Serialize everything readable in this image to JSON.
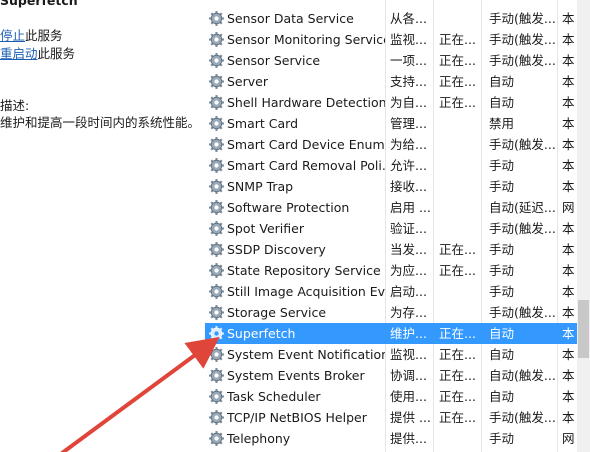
{
  "left_pane": {
    "service_title": "Superfetch",
    "stop_link": "停止",
    "stop_suffix": "此服务",
    "restart_link": "重启动",
    "restart_suffix": "此服务",
    "description_label": "描述:",
    "description_text": "维护和提高一段时间内的系统性能。"
  },
  "rows": [
    {
      "name": "Sensor Data Service",
      "desc": "从各...",
      "status": "",
      "startup": "手动(触发...",
      "logon": "本"
    },
    {
      "name": "Sensor Monitoring Service",
      "desc": "监视...",
      "status": "正在...",
      "startup": "手动(触发...",
      "logon": "本"
    },
    {
      "name": "Sensor Service",
      "desc": "一项...",
      "status": "正在...",
      "startup": "手动(触发...",
      "logon": "本"
    },
    {
      "name": "Server",
      "desc": "支持...",
      "status": "正在...",
      "startup": "自动",
      "logon": "本"
    },
    {
      "name": "Shell Hardware Detection",
      "desc": "为自...",
      "status": "正在...",
      "startup": "自动",
      "logon": "本"
    },
    {
      "name": "Smart Card",
      "desc": "管理...",
      "status": "",
      "startup": "禁用",
      "logon": "本"
    },
    {
      "name": "Smart Card Device Enum...",
      "desc": "为给...",
      "status": "",
      "startup": "手动(触发...",
      "logon": "本"
    },
    {
      "name": "Smart Card Removal Poli...",
      "desc": "允许...",
      "status": "",
      "startup": "手动",
      "logon": "本"
    },
    {
      "name": "SNMP Trap",
      "desc": "接收...",
      "status": "",
      "startup": "手动",
      "logon": "本"
    },
    {
      "name": "Software Protection",
      "desc": "启用 ...",
      "status": "",
      "startup": "自动(延迟...",
      "logon": "网"
    },
    {
      "name": "Spot Verifier",
      "desc": "验证...",
      "status": "",
      "startup": "手动(触发...",
      "logon": "本"
    },
    {
      "name": "SSDP Discovery",
      "desc": "当发...",
      "status": "正在...",
      "startup": "手动",
      "logon": "本"
    },
    {
      "name": "State Repository Service",
      "desc": "为应...",
      "status": "正在...",
      "startup": "手动",
      "logon": "本"
    },
    {
      "name": "Still Image Acquisition Ev...",
      "desc": "启动...",
      "status": "",
      "startup": "手动",
      "logon": "本"
    },
    {
      "name": "Storage Service",
      "desc": "为存...",
      "status": "",
      "startup": "手动(触发...",
      "logon": "本"
    },
    {
      "name": "Superfetch",
      "desc": "维护...",
      "status": "正在...",
      "startup": "自动",
      "logon": "本",
      "selected": true
    },
    {
      "name": "System Event Notification...",
      "desc": "监视...",
      "status": "正在...",
      "startup": "自动",
      "logon": "本"
    },
    {
      "name": "System Events Broker",
      "desc": "协调...",
      "status": "正在...",
      "startup": "自动(触发...",
      "logon": "本"
    },
    {
      "name": "Task Scheduler",
      "desc": "使用...",
      "status": "正在...",
      "startup": "自动",
      "logon": "本"
    },
    {
      "name": "TCP/IP NetBIOS Helper",
      "desc": "提供 ...",
      "status": "正在...",
      "startup": "手动(触发...",
      "logon": "本"
    },
    {
      "name": "Telephony",
      "desc": "提供...",
      "status": "",
      "startup": "手动",
      "logon": "网"
    }
  ],
  "icons": {
    "service": "gear-icon",
    "annotation": "red-arrow-icon"
  },
  "colors": {
    "selection": "#3399ff",
    "link": "#1a5fb4",
    "arrow": "#e0453a"
  }
}
